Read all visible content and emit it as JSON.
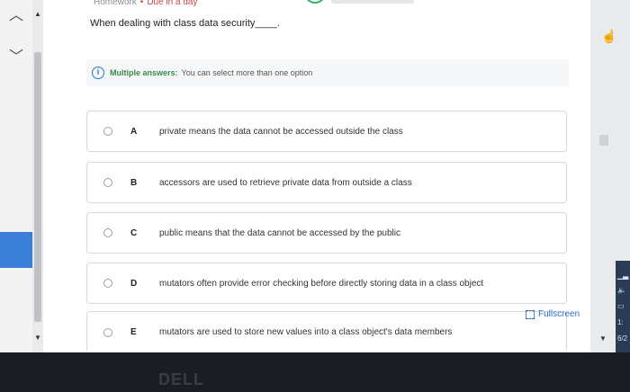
{
  "header": {
    "crumb": "Homework",
    "due": "Due in a day"
  },
  "question": "When dealing with class data security____.",
  "info": {
    "label": "Multiple answers:",
    "text": "You can select more than one option"
  },
  "options": [
    {
      "letter": "A",
      "text": "private means the data cannot be accessed outside the class"
    },
    {
      "letter": "B",
      "text": "accessors are used to retrieve private data from outside a class"
    },
    {
      "letter": "C",
      "text": "public means that the data cannot be accessed by the public"
    },
    {
      "letter": "D",
      "text": "mutators often provide error checking before directly storing data in a class object"
    },
    {
      "letter": "E",
      "text": "mutators are used to store new values into a class object's data members"
    }
  ],
  "fullscreen_label": "Fullscreen",
  "taskbar": {
    "time": "1:",
    "date": "6/2"
  },
  "bezel_logo": "DELL",
  "colors": {
    "accent_blue": "#2a6fbf",
    "info_green": "#3a8a4a",
    "due_red": "#c24b4b"
  }
}
